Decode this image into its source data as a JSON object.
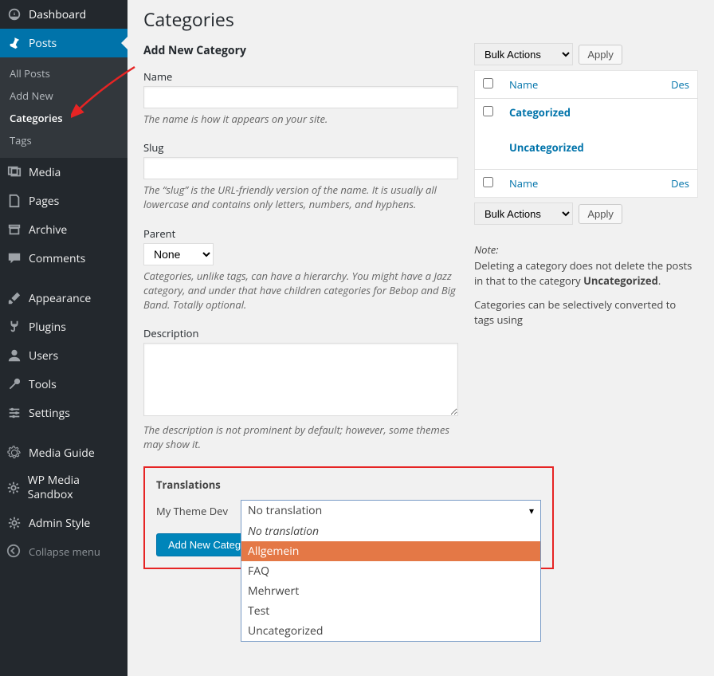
{
  "page": {
    "title": "Categories"
  },
  "sidebar": {
    "dashboard": "Dashboard",
    "posts": "Posts",
    "sub_all": "All Posts",
    "sub_add": "Add New",
    "sub_cat": "Categories",
    "sub_tags": "Tags",
    "media": "Media",
    "pages": "Pages",
    "archive": "Archive",
    "comments": "Comments",
    "appearance": "Appearance",
    "plugins": "Plugins",
    "users": "Users",
    "tools": "Tools",
    "settings": "Settings",
    "mediaguide": "Media Guide",
    "wpmedia": "WP Media Sandbox",
    "adminstyle": "Admin Style",
    "collapse": "Collapse menu"
  },
  "form": {
    "heading": "Add New Category",
    "name_label": "Name",
    "name_help": "The name is how it appears on your site.",
    "slug_label": "Slug",
    "slug_help": "The “slug” is the URL-friendly version of the name. It is usually all lowercase and contains only letters, numbers, and hyphens.",
    "parent_label": "Parent",
    "parent_value": "None",
    "parent_help": "Categories, unlike tags, can have a hierarchy. You might have a Jazz category, and under that have children categories for Bebop and Big Band. Totally optional.",
    "desc_label": "Description",
    "desc_help": "The description is not prominent by default; however, some themes may show it."
  },
  "translations": {
    "heading": "Translations",
    "site_label": "My Theme Dev",
    "selected": "No translation",
    "options": [
      "No translation",
      "Allgemein",
      "FAQ",
      "Mehrwert",
      "Test",
      "Uncategorized"
    ],
    "submit": "Add New Catego"
  },
  "list": {
    "bulk_label": "Bulk Actions",
    "apply": "Apply",
    "col_name": "Name",
    "col_desc": "Des",
    "rows": [
      {
        "title": "Categorized"
      },
      {
        "title": "Uncategorized"
      }
    ],
    "note_label": "Note:",
    "note1": "Deleting a category does not delete the posts in that to the category ",
    "note1_strong": "Uncategorized",
    "note2": "Categories can be selectively converted to tags using"
  }
}
